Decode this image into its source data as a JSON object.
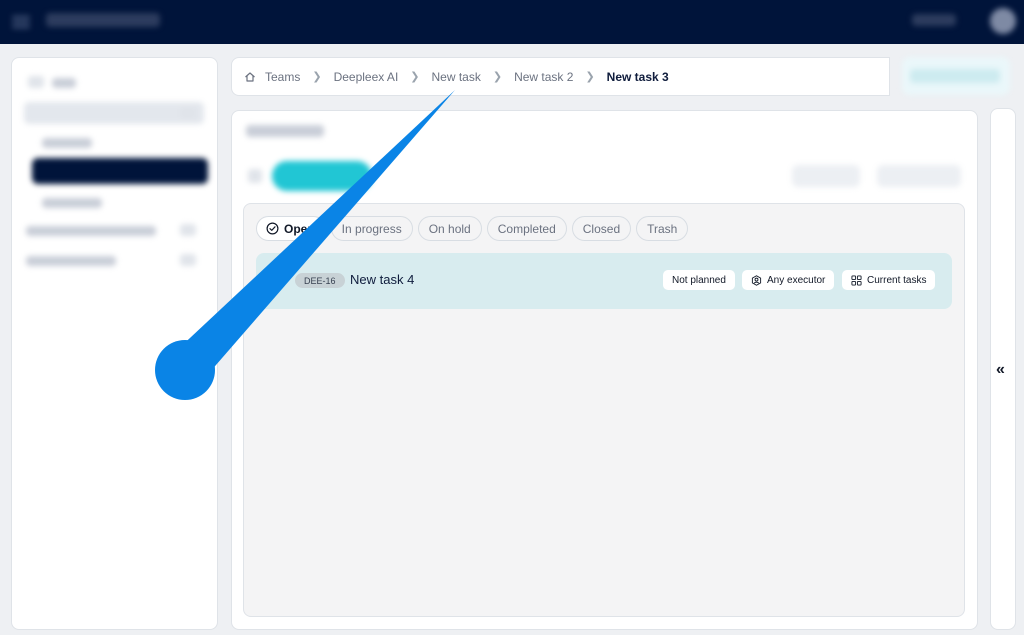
{
  "breadcrumb": {
    "items": [
      "Teams",
      "Deepleex AI",
      "New task",
      "New task 2",
      "New task 3"
    ]
  },
  "status_tabs": [
    {
      "label": "Open",
      "active": true
    },
    {
      "label": "In progress",
      "active": false
    },
    {
      "label": "On hold",
      "active": false
    },
    {
      "label": "Completed",
      "active": false
    },
    {
      "label": "Closed",
      "active": false
    },
    {
      "label": "Trash",
      "active": false
    }
  ],
  "task": {
    "id": "DEE-16",
    "name": "New task 4",
    "plan_status": "Not planned",
    "executor": "Any executor",
    "view": "Current tasks"
  },
  "rail": {
    "collapse_glyph": "«"
  },
  "colors": {
    "topbar": "#00143a",
    "accent_teal": "#21c6d4",
    "task_row": "#d8ecef",
    "pointer": "#0a84e6"
  },
  "icons": {
    "home": "home-icon",
    "open_status": "check-circle-icon",
    "executor": "user-hexagon-icon",
    "view": "grid-icon",
    "collapse": "double-chevron-left-icon"
  }
}
